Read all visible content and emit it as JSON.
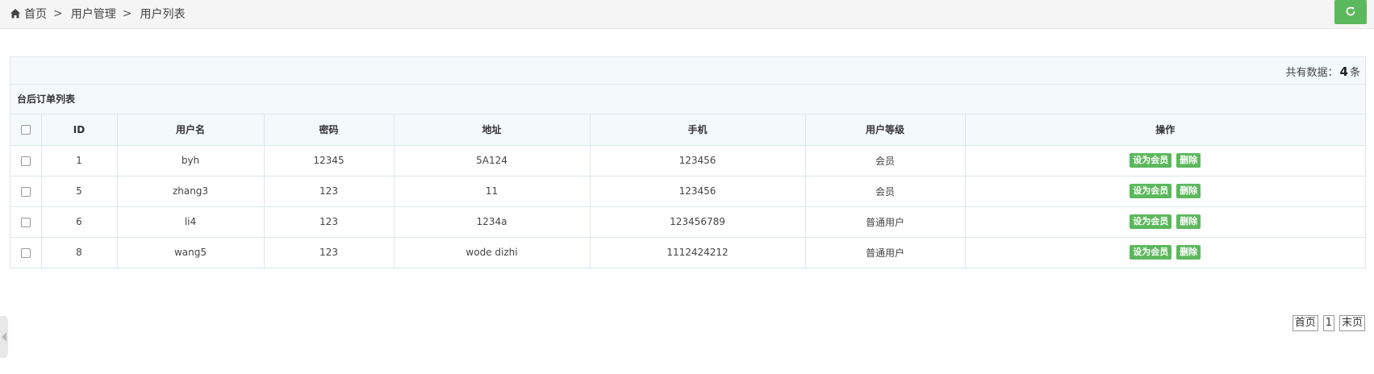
{
  "breadcrumb": [
    "首页",
    "用户管理",
    "用户列表"
  ],
  "breadcrumb_sep": ">",
  "summary": {
    "prefix": "共有数据：",
    "count": "4",
    "suffix": "条"
  },
  "panel_title": "台后订单列表",
  "columns": [
    "ID",
    "用户名",
    "密码",
    "地址",
    "手机",
    "用户等级",
    "操作"
  ],
  "rows": [
    {
      "id": "1",
      "username": "byh",
      "password": "12345",
      "address": "5A124",
      "phone": "123456",
      "level": "会员"
    },
    {
      "id": "5",
      "username": "zhang3",
      "password": "123",
      "address": "11",
      "phone": "123456",
      "level": "会员"
    },
    {
      "id": "6",
      "username": "li4",
      "password": "123",
      "address": "1234a",
      "phone": "123456789",
      "level": "普通用户"
    },
    {
      "id": "8",
      "username": "wang5",
      "password": "123",
      "address": "wode dizhi",
      "phone": "1112424212",
      "level": "普通用户"
    }
  ],
  "actions": {
    "set_member": "设为会员",
    "delete": "删除"
  },
  "pagination": {
    "first": "首页",
    "current": "1",
    "last": "末页"
  },
  "colors": {
    "accent_green": "#5cb85c",
    "table_header_bg": "#f4f9fc",
    "border": "#dde6ee"
  },
  "icons": {
    "home": "home-icon",
    "refresh": "refresh-icon",
    "collapse": "collapse-left-icon"
  }
}
